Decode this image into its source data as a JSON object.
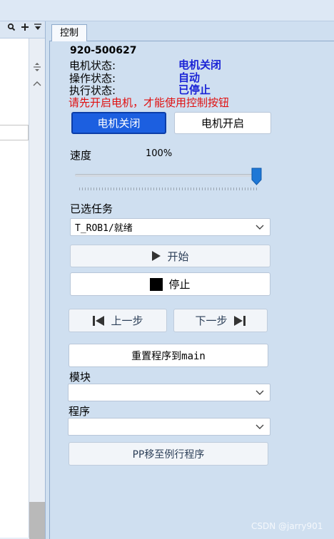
{
  "left_panel": {
    "header_icons": [
      "search-icon",
      "plus-icon",
      "menu-icon"
    ],
    "scroll_icons": [
      "expand-icon",
      "caret-up-icon"
    ]
  },
  "tab": {
    "label": "控制"
  },
  "status": {
    "device_name": "920-500627",
    "rows": [
      {
        "label": "电机状态:",
        "value": "电机关闭"
      },
      {
        "label": "操作状态:",
        "value": "自动"
      },
      {
        "label": "执行状态:",
        "value": "已停止"
      }
    ],
    "warning": "请先开启电机，才能使用控制按钮"
  },
  "motor": {
    "off_label": "电机关闭",
    "on_label": "电机开启",
    "active": "off"
  },
  "speed": {
    "label": "速度",
    "value_text": "100%",
    "value": 100
  },
  "task": {
    "label": "已选任务",
    "selected": "T_ROB1/就绪"
  },
  "controls": {
    "start_label": "开始",
    "stop_label": "停止",
    "prev_label": "上一步",
    "next_label": "下一步",
    "reset_label": "重置程序到main"
  },
  "module": {
    "label": "模块",
    "selected": ""
  },
  "routine": {
    "label": "程序",
    "selected": ""
  },
  "pp_label": "PP移至例行程序",
  "watermark": "CSDN @jarry901",
  "colors": {
    "background": "#cfdff0",
    "accent": "#1c5fe0",
    "status_value": "#1a23d6",
    "warning": "#e01010"
  }
}
